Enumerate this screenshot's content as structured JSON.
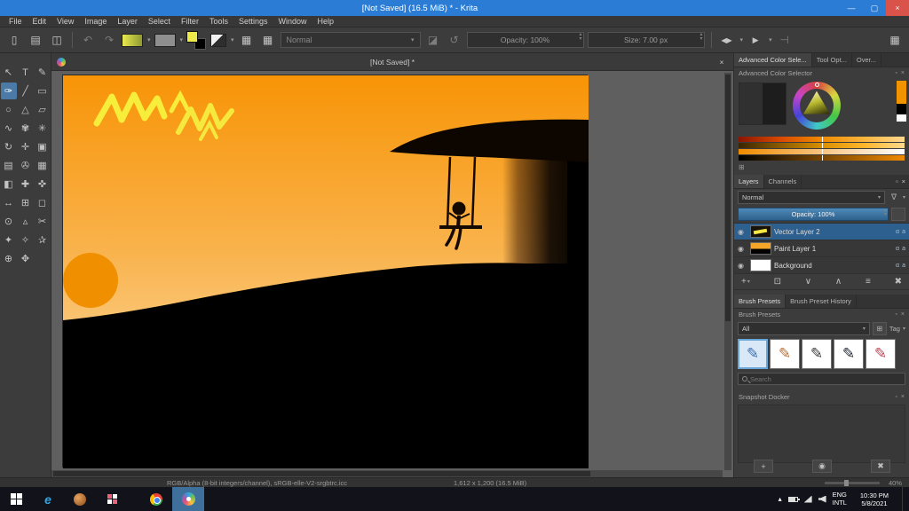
{
  "icons": {
    "new": "▯",
    "open": "▤",
    "save": "◫",
    "undo": "↶",
    "redo": "↷",
    "dropdown": "▾",
    "checker": "▦",
    "eraser": "◪",
    "reload": "↺",
    "mirror": "◀▶",
    "play": "▶",
    "assist": "⊣",
    "workspace": "▦",
    "min": "—",
    "max": "▢",
    "close": "×",
    "float": "▫",
    "eye": "◉",
    "alpha": "α",
    "alpha_lock": "a",
    "add": "+",
    "duplicate": "⊡",
    "move_down": "∨",
    "move_up": "∧",
    "properties": "≡",
    "delete": "✖",
    "filter": "∇",
    "spin_up": "▴",
    "spin_down": "▾",
    "brush": "✎",
    "grid": "⊞",
    "camera": "◉",
    "tray_up": "▴"
  },
  "window": {
    "title": "[Not Saved]  (16.5 MiB)  * - Krita"
  },
  "menubar": {
    "items": [
      "File",
      "Edit",
      "View",
      "Image",
      "Layer",
      "Select",
      "Filter",
      "Tools",
      "Settings",
      "Window",
      "Help"
    ]
  },
  "toolbar": {
    "blend_mode": "Normal",
    "opacity": "Opacity: 100%",
    "size": "Size: 7.00 px"
  },
  "toolbox": {
    "tools": [
      {
        "name": "select-shapes",
        "glyph": "↖"
      },
      {
        "name": "text",
        "glyph": "T"
      },
      {
        "name": "edit-shapes",
        "glyph": "✎"
      },
      {
        "name": "freehand-brush",
        "glyph": "✑"
      },
      {
        "name": "line",
        "glyph": "╱"
      },
      {
        "name": "rectangle",
        "glyph": "▭"
      },
      {
        "name": "ellipse",
        "glyph": "○"
      },
      {
        "name": "polygon",
        "glyph": "△"
      },
      {
        "name": "polyline",
        "glyph": "▱"
      },
      {
        "name": "bezier-curve",
        "glyph": "∿"
      },
      {
        "name": "dynamic-brush",
        "glyph": "✾"
      },
      {
        "name": "multibrush",
        "glyph": "✳"
      },
      {
        "name": "transform",
        "glyph": "↻"
      },
      {
        "name": "move",
        "glyph": "✛"
      },
      {
        "name": "crop",
        "glyph": "▣"
      },
      {
        "name": "gradient",
        "glyph": "▤"
      },
      {
        "name": "color-sampler",
        "glyph": "✇"
      },
      {
        "name": "pattern-edit",
        "glyph": "▦"
      },
      {
        "name": "fill",
        "glyph": "◧"
      },
      {
        "name": "smart-patch",
        "glyph": "✚"
      },
      {
        "name": "assistants",
        "glyph": "✜"
      },
      {
        "name": "measure",
        "glyph": "↔"
      },
      {
        "name": "reference-images",
        "glyph": "⊞"
      },
      {
        "name": "rectangular-select",
        "glyph": "◻"
      },
      {
        "name": "elliptical-select",
        "glyph": "⊙"
      },
      {
        "name": "polygonal-select",
        "glyph": "▵"
      },
      {
        "name": "freehand-select",
        "glyph": "✂"
      },
      {
        "name": "contiguous-select",
        "glyph": "✦"
      },
      {
        "name": "similar-color-select",
        "glyph": "✧"
      },
      {
        "name": "magnetic-select",
        "glyph": "✰"
      },
      {
        "name": "zoom",
        "glyph": "⊕"
      },
      {
        "name": "pan",
        "glyph": "✥"
      }
    ]
  },
  "document": {
    "tab_title": "[Not Saved] *"
  },
  "panel": {
    "tabs": [
      "Advanced Color Sele...",
      "Tool Opt...",
      "Over..."
    ],
    "color_selector": {
      "title": "Advanced Color Selector"
    },
    "layers": {
      "tab_layers": "Layers",
      "tab_channels": "Channels",
      "blend_mode": "Normal",
      "opacity": "Opacity: 100%",
      "rows": [
        {
          "name": "Vector Layer 2"
        },
        {
          "name": "Paint Layer 1"
        },
        {
          "name": "Background"
        }
      ]
    },
    "brushes": {
      "tab_presets": "Brush Presets",
      "tab_history": "Brush Preset History",
      "title": "Brush Presets",
      "filter": "All",
      "tag": "Tag",
      "search": "Search"
    },
    "snapshot": {
      "title": "Snapshot Docker"
    }
  },
  "statusbar": {
    "profile": "RGB/Alpha (8-bit integers/channel), sRGB-elle-V2-srgbtrc.icc",
    "dimensions": "1,612 x 1,200 (16.5 MiB)",
    "zoom": "40%"
  },
  "taskbar": {
    "lang1": "ENG",
    "lang2": "INTL",
    "time": "10:30 PM",
    "date": "5/8/2021"
  },
  "colors": {
    "accent": "#2b7cd5",
    "selection": "#2e608f",
    "sun": "#f09000",
    "sky_top": "#f89406",
    "scribble": "#f7ee3b"
  }
}
